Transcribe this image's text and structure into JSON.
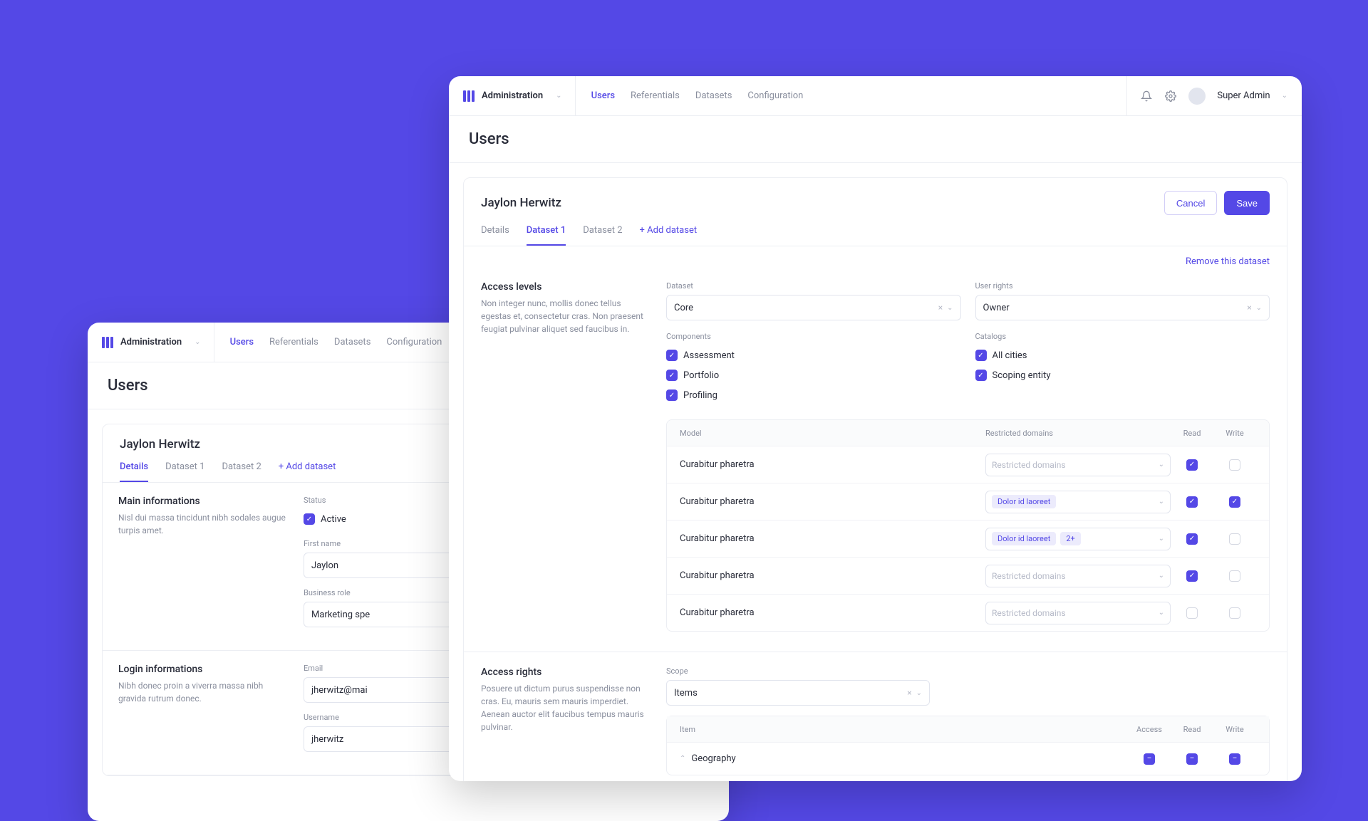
{
  "brand": "Administration",
  "nav": [
    "Users",
    "Referentials",
    "Datasets",
    "Configuration"
  ],
  "nav_active": 0,
  "user": "Super Admin",
  "page_title": "Users",
  "card": {
    "title": "Jaylon Herwitz",
    "cancel": "Cancel",
    "save": "Save",
    "tabs": [
      "Details",
      "Dataset 1",
      "Dataset 2"
    ],
    "add_tab": "+ Add dataset",
    "remove_link": "Remove this dataset"
  },
  "access_levels": {
    "title": "Access levels",
    "desc": "Non integer nunc, mollis donec tellus egestas et, consectetur cras. Non praesent feugiat pulvinar aliquet sed faucibus in.",
    "dataset_label": "Dataset",
    "dataset_value": "Core",
    "rights_label": "User rights",
    "rights_value": "Owner",
    "components_label": "Components",
    "components": [
      "Assessment",
      "Portfolio",
      "Profiling"
    ],
    "catalogs_label": "Catalogs",
    "catalogs": [
      "All cities",
      "Scoping entity"
    ],
    "table": {
      "headers": [
        "Model",
        "Restricted domains",
        "Read",
        "Write"
      ],
      "rows": [
        {
          "model": "Curabitur pharetra",
          "tags": [],
          "placeholder": "Restricted domains",
          "read": true,
          "write": false
        },
        {
          "model": "Curabitur pharetra",
          "tags": [
            "Dolor id laoreet"
          ],
          "placeholder": "",
          "read": true,
          "write": true
        },
        {
          "model": "Curabitur pharetra",
          "tags": [
            "Dolor id laoreet",
            "2+"
          ],
          "placeholder": "",
          "read": true,
          "write": false
        },
        {
          "model": "Curabitur pharetra",
          "tags": [],
          "placeholder": "Restricted domains",
          "read": true,
          "write": false
        },
        {
          "model": "Curabitur pharetra",
          "tags": [],
          "placeholder": "Restricted domains",
          "read": false,
          "write": false
        }
      ]
    }
  },
  "access_rights": {
    "title": "Access rights",
    "desc": "Posuere ut dictum purus suspendisse non cras. Eu, mauris sem mauris imperdiet. Aenean auctor elit faucibus tempus mauris pulvinar.",
    "scope_label": "Scope",
    "scope_value": "Items",
    "table": {
      "headers": [
        "Item",
        "Access",
        "Read",
        "Write"
      ],
      "rows": [
        {
          "name": "Geography",
          "access": "partial",
          "read": "partial",
          "write": "partial"
        }
      ]
    }
  },
  "back_window": {
    "tabs_active": 0,
    "main": {
      "title": "Main informations",
      "desc": "Nisl dui massa tincidunt nibh sodales augue turpis amet.",
      "status_label": "Status",
      "status_value": "Active",
      "first_name_label": "First name",
      "first_name_value": "Jaylon",
      "role_label": "Business role",
      "role_value": "Marketing spe"
    },
    "login": {
      "title": "Login informations",
      "desc": "Nibh donec proin a viverra massa nibh gravida rutrum donec.",
      "email_label": "Email",
      "email_value": "jherwitz@mai",
      "username_label": "Username",
      "username_value": "jherwitz"
    }
  }
}
